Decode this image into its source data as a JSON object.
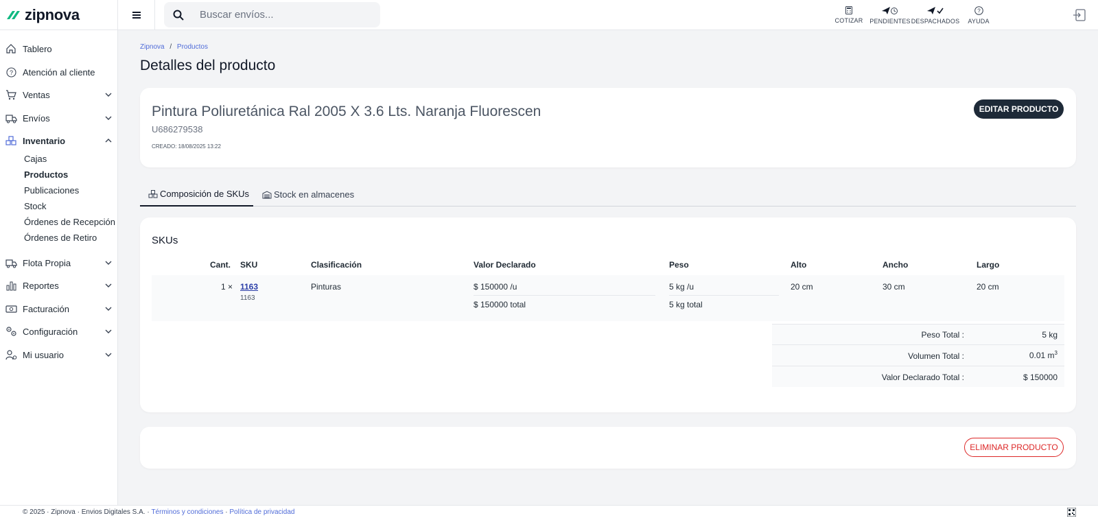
{
  "brand": {
    "name": "zipnova",
    "accent": "#10b981"
  },
  "search": {
    "placeholder": "Buscar envíos..."
  },
  "top_actions": [
    {
      "label": "COTIZAR",
      "icon": "calculator-icon"
    },
    {
      "label": "PENDIENTES",
      "icon": "send-clock-icon"
    },
    {
      "label": "DESPACHADOS",
      "icon": "send-check-icon"
    },
    {
      "label": "AYUDA",
      "icon": "help-circle-icon"
    }
  ],
  "sidebar": {
    "items": [
      {
        "label": "Tablero",
        "icon": "home-icon"
      },
      {
        "label": "Atención al cliente",
        "icon": "help-circle-icon"
      },
      {
        "label": "Ventas",
        "icon": "cart-icon"
      },
      {
        "label": "Envíos",
        "icon": "truck-icon"
      },
      {
        "label": "Inventario",
        "icon": "boxes-icon"
      },
      {
        "label": "Flota Propia",
        "icon": "truck-icon"
      },
      {
        "label": "Reportes",
        "icon": "bar-chart-icon"
      },
      {
        "label": "Facturación",
        "icon": "cash-icon"
      },
      {
        "label": "Configuración",
        "icon": "gears-icon"
      },
      {
        "label": "Mi usuario",
        "icon": "user-gear-icon"
      }
    ],
    "inventario_sub": [
      "Cajas",
      "Productos",
      "Publicaciones",
      "Stock",
      "Órdenes de Recepción",
      "Órdenes de Retiro"
    ]
  },
  "breadcrumb": {
    "home": "Zipnova",
    "separator": "/",
    "current": "Productos"
  },
  "page_title": "Detalles del producto",
  "product": {
    "name": "Pintura Poliuretánica Ral 2005 X 3.6 Lts. Naranja Fluorescen",
    "code": "U686279538",
    "created": "CREADO: 18/08/2025 13:22",
    "edit_label": "EDITAR PRODUCTO"
  },
  "tabs": [
    {
      "label": "Composición de SKUs"
    },
    {
      "label": "Stock en almacenes"
    }
  ],
  "skus": {
    "title": "SKUs",
    "headers": [
      "Cant.",
      "SKU",
      "Clasificación",
      "Valor Declarado",
      "Peso",
      "Alto",
      "Ancho",
      "Largo"
    ],
    "row": {
      "qty": "1 ×",
      "sku": "1163",
      "sku_sub": "1163",
      "classification": "Pinturas",
      "value_unit": "$ 150000 /u",
      "value_total": "$ 150000 total",
      "weight_unit": "5 kg /u",
      "weight_total": "5 kg total",
      "alto": "20 cm",
      "ancho": "30 cm",
      "largo": "20 cm"
    },
    "totals": [
      {
        "label": "Peso Total :",
        "value": "5 kg"
      },
      {
        "label": "Volumen Total :",
        "value": "0.01 m",
        "sup": "3"
      },
      {
        "label": "Valor Declarado Total :",
        "value": "$ 150000"
      }
    ]
  },
  "delete_label": "ELIMINAR PRODUCTO",
  "footer": {
    "copyright": "© 2025 · Zipnova · Envios Digitales S.A. · ",
    "terms": "Términos y condiciones",
    "sep": " · ",
    "privacy": "Política de privacidad"
  }
}
